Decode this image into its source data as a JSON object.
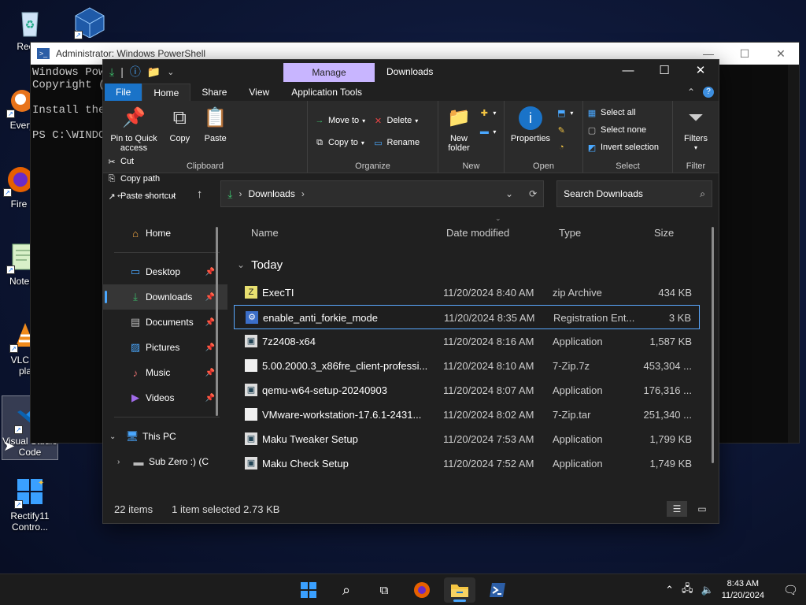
{
  "desktop": {
    "icons": [
      {
        "label": "Recyc",
        "icon": "recycle-bin-icon"
      },
      {
        "label": "",
        "icon": "virtualbox-icon"
      },
      {
        "label": "Every",
        "icon": "everything-icon"
      },
      {
        "label": "Fire",
        "icon": "firefox-icon"
      },
      {
        "label": "Notep",
        "icon": "notepad-icon"
      },
      {
        "label": "VLC m\npla",
        "icon": "vlc-icon"
      },
      {
        "label": "Visual Studio\nCode",
        "icon": "vscode-icon"
      },
      {
        "label": "Rectify11\nContro...",
        "icon": "rectify11-icon"
      }
    ]
  },
  "powershell": {
    "title": "Administrator: Windows PowerShell",
    "lines": [
      "Windows Powe",
      "Copyright ((",
      "",
      "Install the",
      "",
      "PS C:\\WINDOW"
    ]
  },
  "explorer": {
    "manage_tab": "Manage",
    "title": "Downloads",
    "tabs": [
      "File",
      "Home",
      "Share",
      "View",
      "Application Tools"
    ],
    "ribbon": {
      "clipboard": {
        "name": "Clipboard",
        "pin": "Pin to Quick access",
        "copy": "Copy",
        "paste": "Paste",
        "cut": "Cut",
        "copy_path": "Copy path",
        "paste_shortcut": "Paste shortcut"
      },
      "organize": {
        "name": "Organize",
        "move_to": "Move to",
        "copy_to": "Copy to",
        "delete": "Delete",
        "rename": "Rename"
      },
      "new": {
        "name": "New",
        "new_folder": "New folder"
      },
      "open": {
        "name": "Open",
        "properties": "Properties"
      },
      "select": {
        "name": "Select",
        "select_all": "Select all",
        "select_none": "Select none",
        "invert": "Invert selection"
      },
      "filters": {
        "name": "Filter",
        "label": "Filters"
      }
    },
    "address": {
      "path": "Downloads"
    },
    "search": {
      "placeholder": "Search Downloads"
    },
    "nav": [
      {
        "label": "Home",
        "icon": "home-icon",
        "pinned": false
      },
      {
        "label": "Desktop",
        "icon": "desktop-icon",
        "pinned": true
      },
      {
        "label": "Downloads",
        "icon": "download-icon",
        "pinned": true,
        "selected": true
      },
      {
        "label": "Documents",
        "icon": "documents-icon",
        "pinned": true
      },
      {
        "label": "Pictures",
        "icon": "pictures-icon",
        "pinned": true
      },
      {
        "label": "Music",
        "icon": "music-icon",
        "pinned": true
      },
      {
        "label": "Videos",
        "icon": "videos-icon",
        "pinned": true
      },
      {
        "label": "This PC",
        "icon": "this-pc-icon"
      },
      {
        "label": "Sub Zero :) (C",
        "icon": "drive-icon"
      }
    ],
    "columns": {
      "name": "Name",
      "date": "Date modified",
      "type": "Type",
      "size": "Size"
    },
    "group": "Today",
    "files": [
      {
        "name": "ExecTI",
        "date": "11/20/2024 8:40 AM",
        "type": "zip Archive",
        "size": "434 KB"
      },
      {
        "name": "enable_anti_forkie_mode",
        "date": "11/20/2024 8:35 AM",
        "type": "Registration Ent...",
        "size": "3 KB",
        "selected": true
      },
      {
        "name": "7z2408-x64",
        "date": "11/20/2024 8:16 AM",
        "type": "Application",
        "size": "1,587 KB"
      },
      {
        "name": "5.00.2000.3_x86fre_client-professi...",
        "date": "11/20/2024 8:10 AM",
        "type": "7-Zip.7z",
        "size": "453,304 ..."
      },
      {
        "name": "qemu-w64-setup-20240903",
        "date": "11/20/2024 8:07 AM",
        "type": "Application",
        "size": "176,316 ..."
      },
      {
        "name": "VMware-workstation-17.6.1-2431...",
        "date": "11/20/2024 8:02 AM",
        "type": "7-Zip.tar",
        "size": "251,340 ..."
      },
      {
        "name": "Maku Tweaker Setup",
        "date": "11/20/2024 7:53 AM",
        "type": "Application",
        "size": "1,799 KB"
      },
      {
        "name": "Maku Check Setup",
        "date": "11/20/2024 7:52 AM",
        "type": "Application",
        "size": "1,749 KB"
      }
    ],
    "status": {
      "count": "22 items",
      "selection": "1 item selected  2.73 KB"
    }
  },
  "taskbar": {
    "time": "8:43 AM",
    "date": "11/20/2024"
  }
}
